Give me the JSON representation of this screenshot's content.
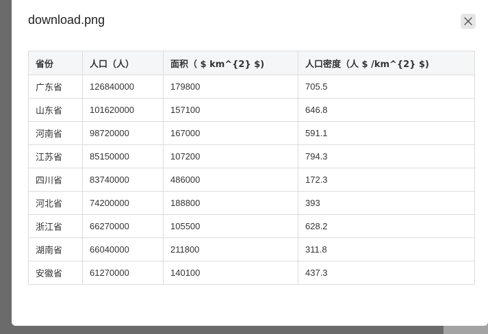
{
  "modal": {
    "title": "download.png",
    "close_icon": "close-icon"
  },
  "table": {
    "headers": [
      "省份",
      "人口（人）",
      "面积（ $ km^{2} $)",
      "人口密度（人 $ /km^{2} $)"
    ],
    "rows": [
      [
        "广东省",
        "126840000",
        "179800",
        "705.5"
      ],
      [
        "山东省",
        "101620000",
        "157100",
        "646.8"
      ],
      [
        "河南省",
        "98720000",
        "167000",
        "591.1"
      ],
      [
        "江苏省",
        "85150000",
        "107200",
        "794.3"
      ],
      [
        "四川省",
        "83740000",
        "486000",
        "172.3"
      ],
      [
        "河北省",
        "74200000",
        "188800",
        "393"
      ],
      [
        "浙江省",
        "66270000",
        "105500",
        "628.2"
      ],
      [
        "湖南省",
        "66040000",
        "211800",
        "311.8"
      ],
      [
        "安徽省",
        "61270000",
        "140100",
        "437.3"
      ]
    ]
  }
}
